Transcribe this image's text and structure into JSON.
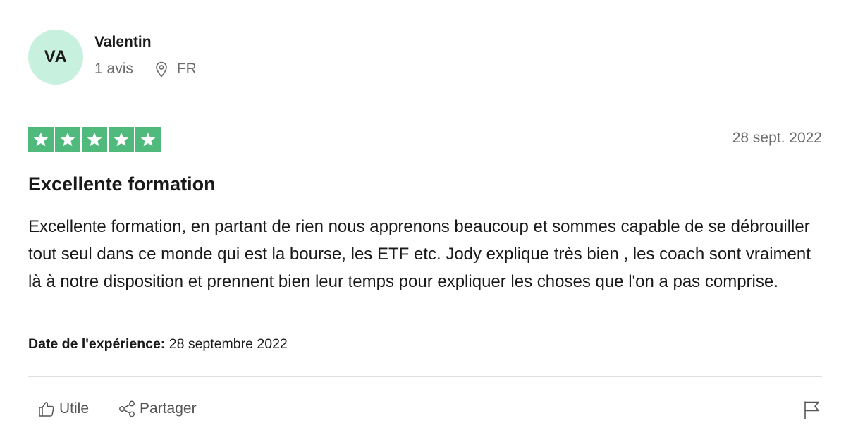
{
  "reviewer": {
    "initials": "VA",
    "name": "Valentin",
    "review_count": "1 avis",
    "country": "FR",
    "avatar_color": "#c8f0de"
  },
  "review": {
    "rating": 5,
    "rating_max": 5,
    "star_color": "#4fba7c",
    "date": "28 sept. 2022",
    "title": "Excellente formation",
    "body": "Excellente formation, en partant de rien nous apprenons beaucoup et sommes capable de se débrouiller tout seul dans ce monde qui est la bourse, les ETF etc. Jody explique très bien , les coach sont vraiment là à notre disposition et prennent bien leur temps pour expliquer les choses que l'on a pas comprise.",
    "experience_label": "Date de l'expérience:",
    "experience_date": "28 septembre 2022"
  },
  "actions": {
    "useful_label": "Utile",
    "share_label": "Partager"
  },
  "icons": {
    "location": "location-pin-icon",
    "useful": "thumbs-up-icon",
    "share": "share-icon",
    "report": "flag-icon",
    "star": "star-icon"
  }
}
